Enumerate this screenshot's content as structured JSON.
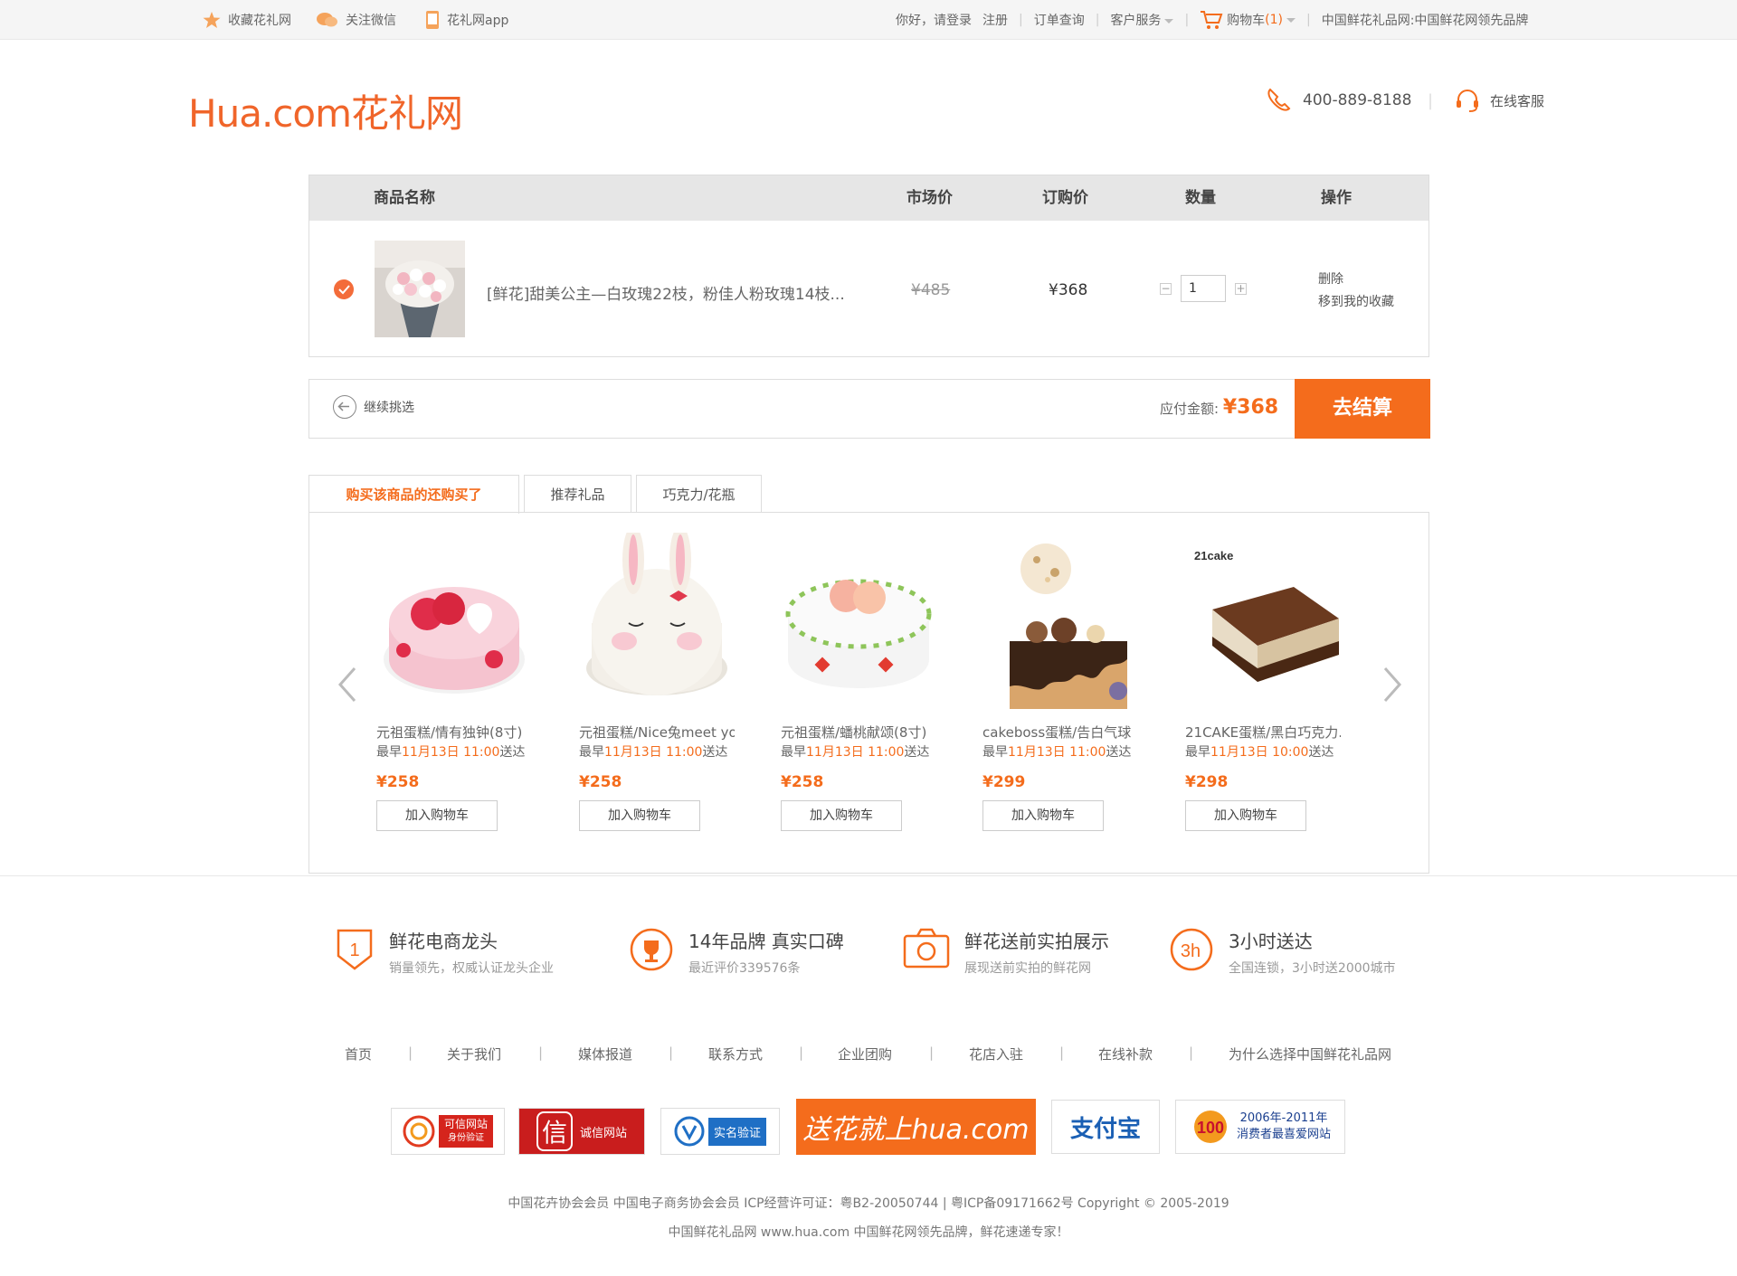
{
  "topbar": {
    "fav": "收藏花礼网",
    "wechat": "关注微信",
    "app": "花礼网app",
    "greeting": "你好，请登录",
    "register": "注册",
    "orders": "订单查询",
    "service": "客户服务",
    "cart_label": "购物车",
    "cart_count": "(1)",
    "slogan": "中国鲜花礼品网:中国鲜花网领先品牌"
  },
  "header": {
    "logo": "Hua.com花礼网",
    "phone": "400-889-8188",
    "online_service": "在线客服"
  },
  "cart": {
    "columns": [
      "商品名称",
      "市场价",
      "订购价",
      "数量",
      "操作"
    ],
    "item": {
      "name": "[鲜花]甜美公主—白玫瑰22枝，粉佳人粉玫瑰14枝...",
      "market_price": "¥485",
      "order_price": "¥368",
      "quantity": "1",
      "delete": "删除",
      "move_fav": "移到我的收藏"
    },
    "continue": "继续挑选",
    "total_label": "应付金额:",
    "total_value": "¥368",
    "checkout": "去结算"
  },
  "tabs": [
    "购买该商品的还购买了",
    "推荐礼品",
    "巧克力/花瓶"
  ],
  "products": [
    {
      "title": "元祖蛋糕/情有独钟(8寸)",
      "date_pre": "最早",
      "date": "11月13日 11:00",
      "date_post": "送达",
      "price": "¥258",
      "button": "加入购物车"
    },
    {
      "title": "元祖蛋糕/Nice兔meet you...",
      "date_pre": "最早",
      "date": "11月13日 11:00",
      "date_post": "送达",
      "price": "¥258",
      "button": "加入购物车"
    },
    {
      "title": "元祖蛋糕/蟠桃献颂(8寸)",
      "date_pre": "最早",
      "date": "11月13日 11:00",
      "date_post": "送达",
      "price": "¥258",
      "button": "加入购物车"
    },
    {
      "title": "cakeboss蛋糕/告白气球（...",
      "date_pre": "最早",
      "date": "11月13日 11:00",
      "date_post": "送达",
      "price": "¥299",
      "button": "加入购物车"
    },
    {
      "title": "21CAKE蛋糕/黑白巧克力...",
      "date_pre": "最早",
      "date": "11月13日 10:00",
      "date_post": "送达",
      "price": "¥298",
      "button": "加入购物车"
    }
  ],
  "features": [
    {
      "title": "鲜花电商龙头",
      "sub": "销量领先，权威认证龙头企业"
    },
    {
      "title": "14年品牌 真实口碑",
      "sub": "最近评价339576条"
    },
    {
      "title": "鲜花送前实拍展示",
      "sub": "展现送前实拍的鲜花网"
    },
    {
      "title": "3小时送达",
      "sub": "全国连锁，3小时送2000城市"
    }
  ],
  "footer_links": [
    "首页",
    "关于我们",
    "媒体报道",
    "联系方式",
    "企业团购",
    "花店入驻",
    "在线补款",
    "为什么选择中国鲜花礼品网"
  ],
  "badges": {
    "b1a": "可信网站",
    "b1b": "身份验证",
    "b2a": "信",
    "b2b": "诚信网站",
    "b3a": "实名验证",
    "b4": "送花就上hua.com",
    "b5": "支付宝",
    "b6a": "2006年-2011年",
    "b6b": "消费者最喜爱网站"
  },
  "copyright": {
    "line1": "中国花卉协会会员 中国电子商务协会会员 ICP经营许可证：粤B2-20050744 | 粤ICP备09171662号 Copyright © 2005-2019",
    "line2": "中国鲜花礼品网 www.hua.com 中国鲜花网领先品牌，鲜花速递专家！"
  },
  "colors": {
    "accent": "#f46c1c",
    "check": "#f36c3a"
  }
}
